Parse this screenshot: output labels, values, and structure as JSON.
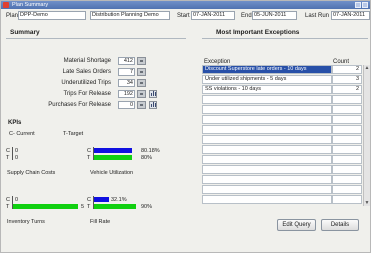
{
  "window": {
    "title": "Plan Summary"
  },
  "header": {
    "plan_label": "Plan",
    "plan_value": "DPP-Demo",
    "plan_desc": "Distribution Planning Demo",
    "start_label": "Start",
    "start_value": "07-JAN-2011",
    "end_label": "End",
    "end_value": "05-JUN-2011",
    "last_run_label": "Last Run",
    "last_run_value": "07-JAN-2011"
  },
  "summary": {
    "title": "Summary",
    "rows": [
      {
        "label": "Material Shortage",
        "value": "412"
      },
      {
        "label": "Late Sales Orders",
        "value": "7"
      },
      {
        "label": "Underutilized Trips",
        "value": "34"
      },
      {
        "label": "Trips For Release",
        "value": "192"
      },
      {
        "label": "Purchases For Release",
        "value": "0"
      }
    ]
  },
  "kpis": {
    "title": "KPIs",
    "legend_current": "C- Current",
    "legend_target": "T-Target",
    "c_letter": "C",
    "t_letter": "T",
    "items": [
      {
        "name": "Supply Chain Costs",
        "current_label": "0",
        "target_label": "0",
        "current": 0,
        "target": 0
      },
      {
        "name": "Vehicle Utilization",
        "current_label": "80.18%",
        "target_label": "80%",
        "current": 80.18,
        "target": 80
      },
      {
        "name": "Inventory Turns",
        "current_label": "0",
        "target_label": "5",
        "current": 0,
        "target": 5
      },
      {
        "name": "Fill Rate",
        "current_label": "32.1%",
        "target_label": "90%",
        "current": 32.1,
        "target": 90
      }
    ],
    "colors": {
      "current": "#1010e0",
      "target": "#10d010"
    }
  },
  "exceptions": {
    "title": "Most Important Exceptions",
    "col_exception": "Exception",
    "col_count": "Count",
    "rows": [
      {
        "exception": "Discount Superstore late orders - 10 days",
        "count": "2"
      },
      {
        "exception": "Under utilized shipments - 5 days",
        "count": "3"
      },
      {
        "exception": "SS violations - 10 days",
        "count": "2"
      },
      {
        "exception": "",
        "count": ""
      },
      {
        "exception": "",
        "count": ""
      },
      {
        "exception": "",
        "count": ""
      },
      {
        "exception": "",
        "count": ""
      },
      {
        "exception": "",
        "count": ""
      },
      {
        "exception": "",
        "count": ""
      },
      {
        "exception": "",
        "count": ""
      },
      {
        "exception": "",
        "count": ""
      },
      {
        "exception": "",
        "count": ""
      },
      {
        "exception": "",
        "count": ""
      },
      {
        "exception": "",
        "count": ""
      }
    ]
  },
  "buttons": {
    "edit_query": "Edit Query",
    "details": "Details"
  },
  "colors": {
    "title_bar": "#5072b0",
    "selected_row": "#2850a8"
  }
}
